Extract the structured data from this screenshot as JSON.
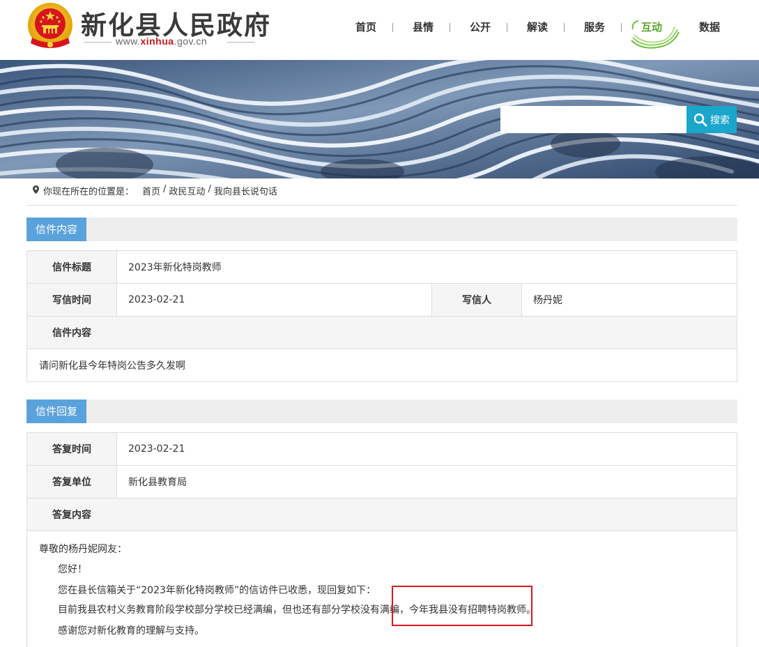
{
  "header": {
    "site_title": "新化县人民政府",
    "site_url_prefix": "www.",
    "site_url_accent": "xinhua",
    "site_url_suffix": ".gov.cn",
    "nav": [
      "首页",
      "县情",
      "公开",
      "解读",
      "服务",
      "互动",
      "数据"
    ],
    "active_nav": "互动"
  },
  "search": {
    "placeholder": "",
    "button_label": "搜索"
  },
  "breadcrumb": {
    "prefix": "你现在所在的位置是：",
    "items": [
      "首页",
      "政民互动",
      "我向县长说句话"
    ]
  },
  "letter": {
    "section_title": "信件内容",
    "title_label": "信件标题",
    "title_value": "2023年新化特岗教师",
    "time_label": "写信时间",
    "time_value": "2023-02-21",
    "author_label": "写信人",
    "author_value": "杨丹妮",
    "content_label": "信件内容",
    "content_value": "请问新化县今年特岗公告多久发啊"
  },
  "reply": {
    "section_title": "信件回复",
    "time_label": "答复时间",
    "time_value": "2023-02-21",
    "unit_label": "答复单位",
    "unit_value": "新化县教育局",
    "content_label": "答复内容",
    "lines": [
      "尊敬的杨丹妮网友：",
      "您好！",
      "您在县长信箱关于“2023年新化特岗教师”的信访件已收悉，现回复如下：",
      "目前我县农村义务教育阶段学校部分学校已经满编，但也还有部分学校没有满编，今年我县没有招聘特岗教师。",
      "感谢您对新化教育的理解与支持。"
    ]
  },
  "colors": {
    "accent_green": "#5ba12a",
    "tab_blue": "#5aa2dc",
    "search_button": "#1ba6cc",
    "highlight_red": "#d9161f"
  }
}
